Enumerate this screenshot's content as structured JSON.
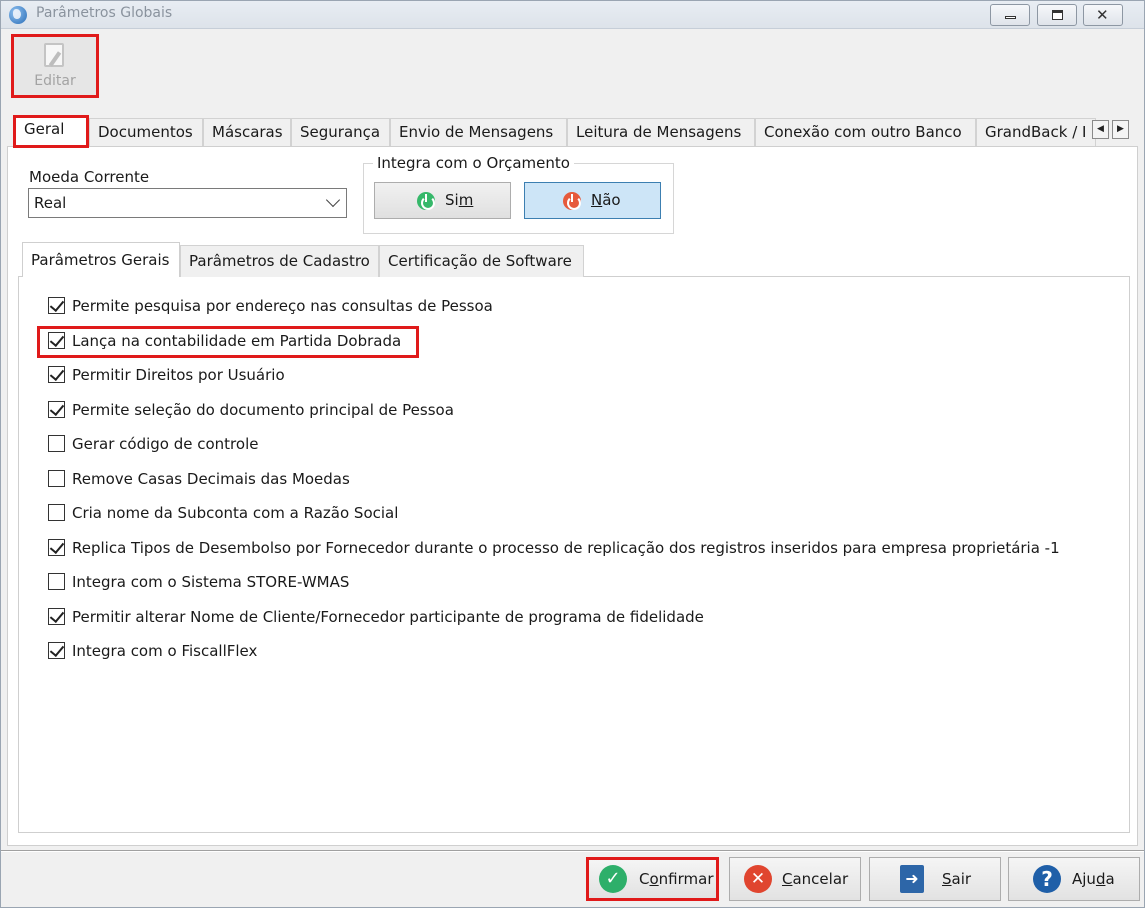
{
  "window": {
    "title": "Parâmetros Globais"
  },
  "toolbar": {
    "edit_label": "Editar"
  },
  "tabs": [
    {
      "label": "Geral",
      "active": true
    },
    {
      "label": "Documentos"
    },
    {
      "label": "Máscaras"
    },
    {
      "label": "Segurança"
    },
    {
      "label": "Envio de Mensagens"
    },
    {
      "label": "Leitura de Mensagens"
    },
    {
      "label": "Conexão com outro Banco"
    },
    {
      "label": "GrandBack / I"
    }
  ],
  "moeda": {
    "label": "Moeda Corrente",
    "value": "Real"
  },
  "integra_orcamento": {
    "legend": "Integra com o Orçamento",
    "sim_prefix": "Si",
    "sim_ul": "m",
    "nao_ul": "N",
    "nao_suffix": "ão",
    "selected": "Não"
  },
  "subtabs": [
    {
      "label": "Parâmetros Gerais",
      "active": true
    },
    {
      "label": "Parâmetros de Cadastro"
    },
    {
      "label": "Certificação de Software"
    }
  ],
  "checkboxes": [
    {
      "label": "Permite pesquisa por endereço nas consultas de Pessoa",
      "checked": true
    },
    {
      "label": "Lança na contabilidade em Partida Dobrada",
      "checked": true
    },
    {
      "label": "Permitir Direitos por Usuário",
      "checked": true
    },
    {
      "label": "Permite seleção do documento principal de Pessoa",
      "checked": true
    },
    {
      "label": "Gerar código de controle",
      "checked": false
    },
    {
      "label": "Remove Casas Decimais das Moedas",
      "checked": false
    },
    {
      "label": "Cria nome da Subconta com a Razão Social",
      "checked": false
    },
    {
      "label": "Replica Tipos de Desembolso por Fornecedor durante o processo de replicação dos registros inseridos para empresa proprietária -1",
      "checked": true
    },
    {
      "label": "Integra com o Sistema STORE-WMAS",
      "checked": false
    },
    {
      "label": "Permitir alterar Nome de Cliente/Fornecedor participante de programa de fidelidade",
      "checked": true
    },
    {
      "label": "Integra com o FiscallFlex",
      "checked": true
    }
  ],
  "buttons": {
    "confirm_a": "C",
    "confirm_ul": "o",
    "confirm_b": "nfirmar",
    "cancel_ul": "C",
    "cancel_rest": "ancelar",
    "exit_ul": "S",
    "exit_rest": "air",
    "help_a": "Aju",
    "help_ul": "d",
    "help_b": "a"
  },
  "colors": {
    "highlight": "#e01a1a",
    "selected_toggle": "#cde5f7"
  }
}
